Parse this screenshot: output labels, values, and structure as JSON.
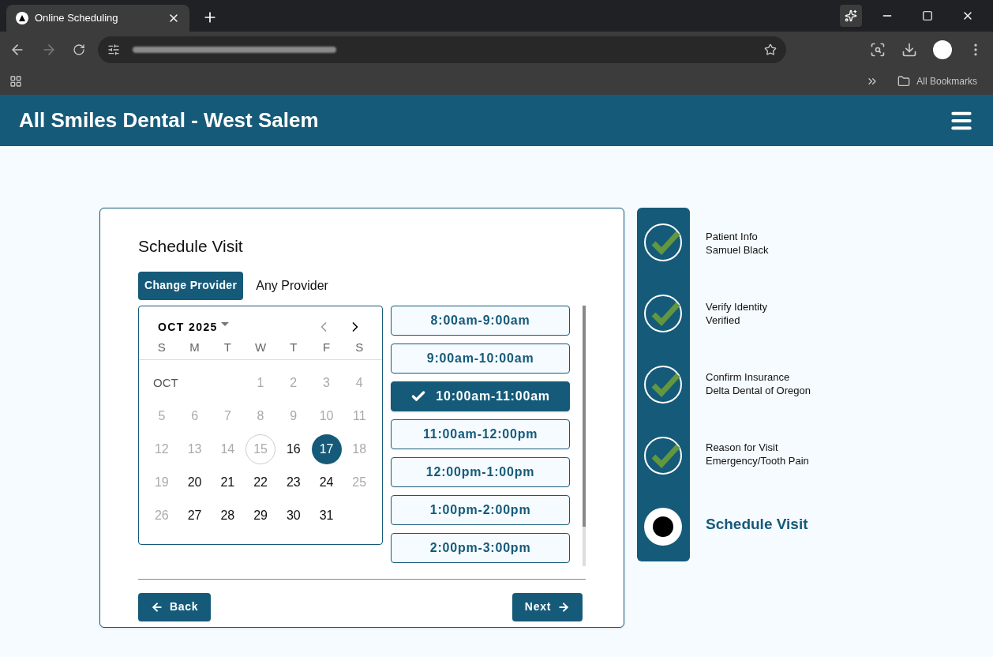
{
  "browser": {
    "tab_title": "Online Scheduling",
    "bookmarks_label": "All Bookmarks"
  },
  "header": {
    "title": "All Smiles Dental - West Salem"
  },
  "card": {
    "title": "Schedule Visit",
    "provider_tabs": [
      {
        "label": "Change Provider",
        "selected": true
      },
      {
        "label": "Any Provider",
        "selected": false
      }
    ],
    "calendar": {
      "month_year": "OCT 2025",
      "month_label": "OCT",
      "weekdays": [
        "S",
        "M",
        "T",
        "W",
        "T",
        "F",
        "S"
      ],
      "weeks": [
        [
          {
            "day": "1",
            "disabled": true,
            "today": false,
            "selected": false
          },
          {
            "day": "2",
            "disabled": true,
            "today": false,
            "selected": false
          },
          {
            "day": "3",
            "disabled": true,
            "today": false,
            "selected": false
          },
          {
            "day": "4",
            "disabled": true,
            "today": false,
            "selected": false
          }
        ],
        [
          {
            "day": "5",
            "disabled": true,
            "today": false,
            "selected": false
          },
          {
            "day": "6",
            "disabled": true,
            "today": false,
            "selected": false
          },
          {
            "day": "7",
            "disabled": true,
            "today": false,
            "selected": false
          },
          {
            "day": "8",
            "disabled": true,
            "today": false,
            "selected": false
          },
          {
            "day": "9",
            "disabled": true,
            "today": false,
            "selected": false
          },
          {
            "day": "10",
            "disabled": true,
            "today": false,
            "selected": false
          },
          {
            "day": "11",
            "disabled": true,
            "today": false,
            "selected": false
          }
        ],
        [
          {
            "day": "12",
            "disabled": true,
            "today": false,
            "selected": false
          },
          {
            "day": "13",
            "disabled": true,
            "today": false,
            "selected": false
          },
          {
            "day": "14",
            "disabled": true,
            "today": false,
            "selected": false
          },
          {
            "day": "15",
            "disabled": true,
            "today": true,
            "selected": false
          },
          {
            "day": "16",
            "disabled": false,
            "today": false,
            "selected": false
          },
          {
            "day": "17",
            "disabled": false,
            "today": false,
            "selected": true
          },
          {
            "day": "18",
            "disabled": true,
            "today": false,
            "selected": false
          }
        ],
        [
          {
            "day": "19",
            "disabled": true,
            "today": false,
            "selected": false
          },
          {
            "day": "20",
            "disabled": false,
            "today": false,
            "selected": false
          },
          {
            "day": "21",
            "disabled": false,
            "today": false,
            "selected": false
          },
          {
            "day": "22",
            "disabled": false,
            "today": false,
            "selected": false
          },
          {
            "day": "23",
            "disabled": false,
            "today": false,
            "selected": false
          },
          {
            "day": "24",
            "disabled": false,
            "today": false,
            "selected": false
          },
          {
            "day": "25",
            "disabled": true,
            "today": false,
            "selected": false
          }
        ],
        [
          {
            "day": "26",
            "disabled": true,
            "today": false,
            "selected": false
          },
          {
            "day": "27",
            "disabled": false,
            "today": false,
            "selected": false
          },
          {
            "day": "28",
            "disabled": false,
            "today": false,
            "selected": false
          },
          {
            "day": "29",
            "disabled": false,
            "today": false,
            "selected": false
          },
          {
            "day": "30",
            "disabled": false,
            "today": false,
            "selected": false
          },
          {
            "day": "31",
            "disabled": false,
            "today": false,
            "selected": false
          }
        ]
      ]
    },
    "time_slots": [
      {
        "label": "8:00am-9:00am",
        "selected": false
      },
      {
        "label": "9:00am-10:00am",
        "selected": false
      },
      {
        "label": "10:00am-11:00am",
        "selected": true
      },
      {
        "label": "11:00am-12:00pm",
        "selected": false
      },
      {
        "label": "12:00pm-1:00pm",
        "selected": false
      },
      {
        "label": "1:00pm-2:00pm",
        "selected": false
      },
      {
        "label": "2:00pm-3:00pm",
        "selected": false
      }
    ],
    "back_button": "Back",
    "next_button": "Next"
  },
  "steps": [
    {
      "kind": "done",
      "title": "Patient Info",
      "detail": "Samuel Black"
    },
    {
      "kind": "done",
      "title": "Verify Identity",
      "detail": "Verified"
    },
    {
      "kind": "done",
      "title": "Confirm Insurance",
      "detail": "Delta Dental of Oregon"
    },
    {
      "kind": "done",
      "title": "Reason for Visit",
      "detail": "Emergency/Tooth Pain"
    },
    {
      "kind": "current",
      "title": "Schedule Visit"
    }
  ]
}
